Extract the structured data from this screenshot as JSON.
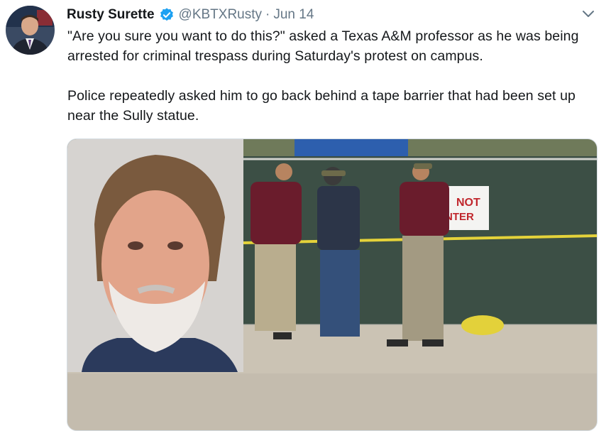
{
  "tweet": {
    "author": {
      "display_name": "Rusty Surette",
      "handle": "@KBTXRusty",
      "verified": true,
      "avatar_icon": "profile-photo"
    },
    "separator": "·",
    "date": "Jun 14",
    "menu_icon": "chevron-down-icon",
    "text_paragraphs": [
      "\"Are you sure you want to do this?\" asked a Texas A&M professor as he was being arrested for criminal trespass during Saturday's protest on campus.",
      "Police repeatedly asked him to go back behind a tape barrier that had been set up near the Sully statue."
    ],
    "media": {
      "sign_text_line1": "NOT",
      "sign_text_line2": "NTER"
    }
  },
  "colors": {
    "text": "#14171a",
    "secondary_text": "#657786",
    "verified_blue": "#1da1f2",
    "border": "#d5dde3"
  }
}
